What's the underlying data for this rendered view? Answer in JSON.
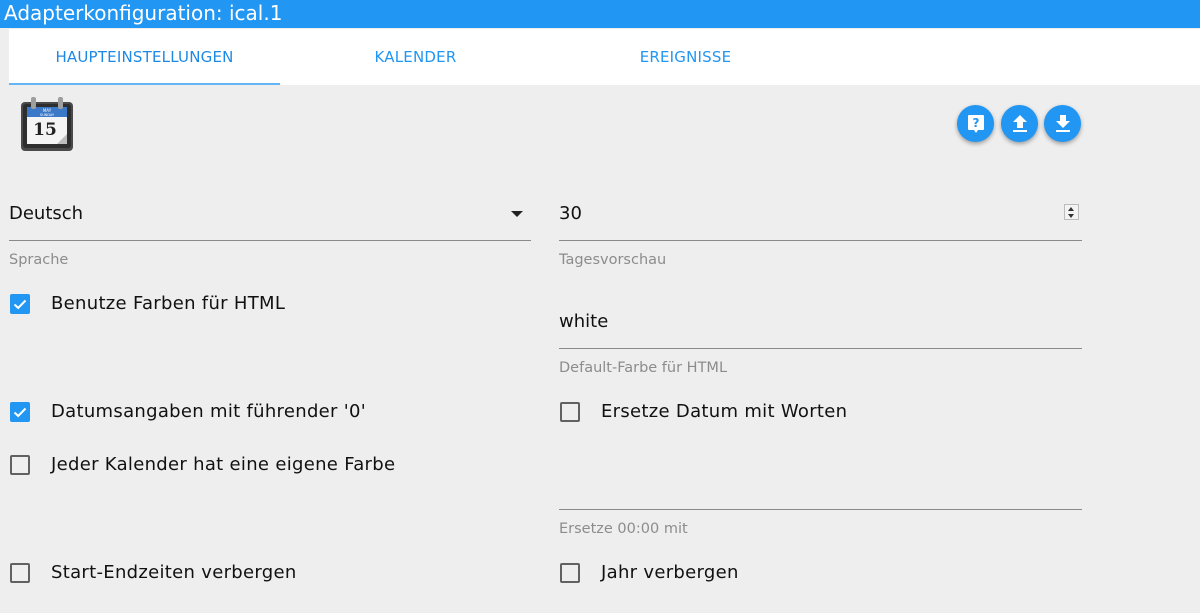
{
  "window": {
    "title": "Adapterkonfiguration: ical.1"
  },
  "tabs": [
    {
      "label": "HAUPTEINSTELLUNGEN",
      "active": true
    },
    {
      "label": "KALENDER",
      "active": false
    },
    {
      "label": "EREIGNISSE",
      "active": false
    }
  ],
  "logo": {
    "icon": "calendar-icon",
    "month": "MAY",
    "day_name": "SUNDAY",
    "day": "15"
  },
  "toolbar": {
    "buttons": [
      {
        "icon": "help-icon"
      },
      {
        "icon": "upload-icon"
      },
      {
        "icon": "download-icon"
      }
    ]
  },
  "accent_color": "#2196f3",
  "fields": {
    "language": {
      "value": "Deutsch",
      "label": "Sprache"
    },
    "preview_days": {
      "value": "30",
      "label": "Tagesvorschau"
    },
    "default_color": {
      "value": "white",
      "label": "Default-Farbe für HTML"
    },
    "replace_midnight": {
      "value": "",
      "label": "Ersetze 00:00 mit"
    }
  },
  "checkboxes": {
    "use_colors": {
      "label": "Benutze Farben für HTML",
      "checked": true
    },
    "leading_zero": {
      "label": "Datumsangaben mit führender '0'",
      "checked": true
    },
    "replace_date": {
      "label": "Ersetze Datum mit Worten",
      "checked": false
    },
    "own_colors": {
      "label": "Jeder Kalender hat eine eigene Farbe",
      "checked": false
    },
    "hide_times": {
      "label": "Start-Endzeiten verbergen",
      "checked": false
    },
    "hide_year": {
      "label": "Jahr verbergen",
      "checked": false
    }
  }
}
